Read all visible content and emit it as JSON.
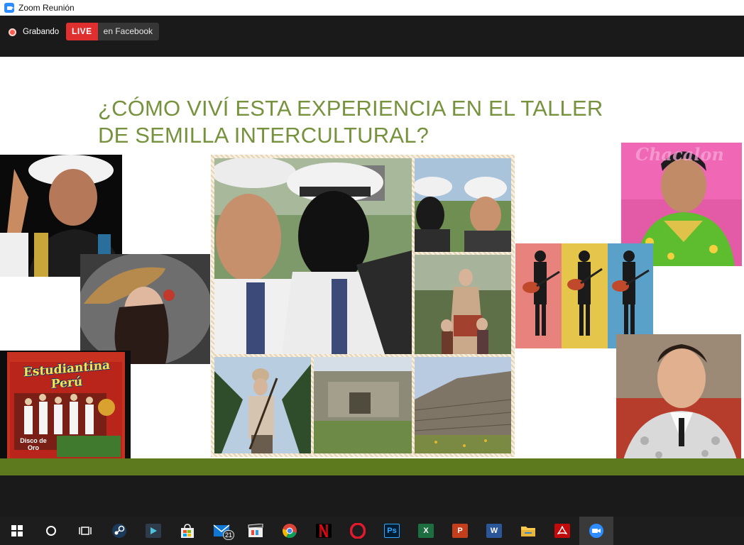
{
  "window": {
    "title": "Zoom Reunión"
  },
  "meeting_bar": {
    "recording_label": "Grabando",
    "live_label": "LIVE",
    "live_target": "en Facebook"
  },
  "slide": {
    "title": "¿CÓMO VIVÍ ESTA EXPERIENCIA EN EL TALLER DE SEMILLA INTERCULTURAL?",
    "album_title": "Estudiantina Perú",
    "album_badge": "Disco de Oro",
    "chabuca_text": "Chacalon"
  },
  "taskbar": {
    "mail_badge": "21",
    "photoshop_label": "Ps",
    "excel_label": "X",
    "powerpoint_label": "P",
    "word_label": "W"
  },
  "colors": {
    "slide_title": "#76923c",
    "green_bar": "#5e7a1f",
    "live": "#e02f2f",
    "zoom_blue": "#2d8cff"
  }
}
